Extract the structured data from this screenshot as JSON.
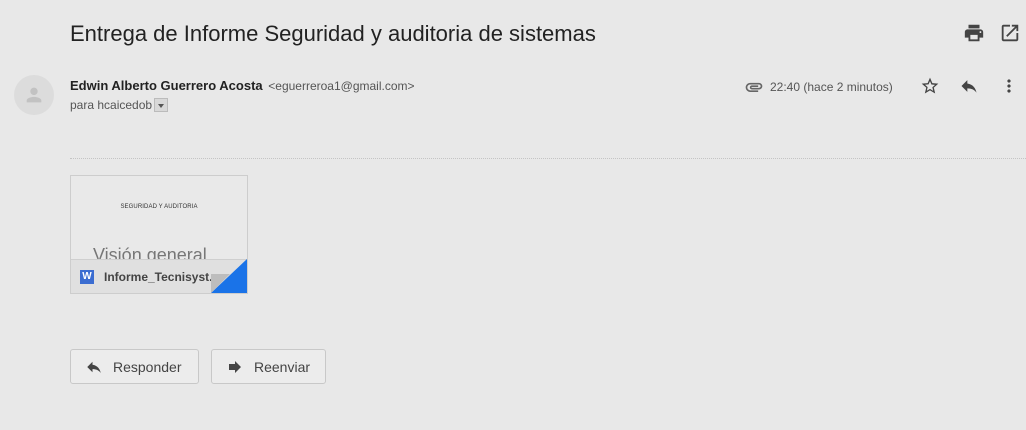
{
  "email": {
    "subject": "Entrega de Informe Seguridad y auditoria de sistemas",
    "sender_name": "Edwin Alberto Guerrero Acosta",
    "sender_email": "<eguerreroa1@gmail.com>",
    "recipient": "para hcaicedob",
    "time": "22:40 (hace 2 minutos)"
  },
  "attachment": {
    "preview_title": "SEGURIDAD Y AUDITORIA",
    "preview_heading": "Visión general",
    "file_icon": "W",
    "file_name": "Informe_Tecnisyst..."
  },
  "actions": {
    "reply_label": "Responder",
    "forward_label": "Reenviar"
  },
  "icons": {
    "print": "print-icon",
    "open_new_window": "open-in-new-window-icon",
    "attachment": "paperclip-icon",
    "star": "star-icon",
    "reply": "reply-icon",
    "more": "more-vertical-icon",
    "avatar": "person-icon",
    "forward": "forward-icon"
  },
  "colors": {
    "background": "#e8e8e8",
    "word_blue": "#3b6dd1",
    "corner_blue": "#1a73e8"
  }
}
